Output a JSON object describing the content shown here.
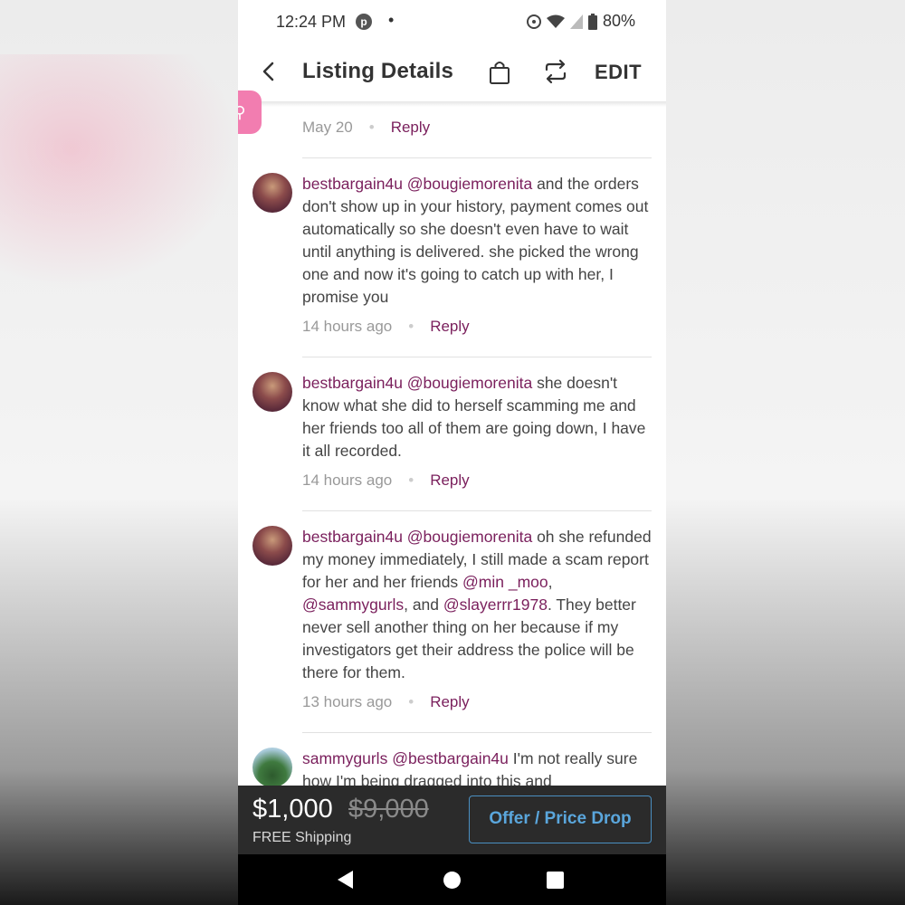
{
  "status_bar": {
    "time": "12:24 PM",
    "battery": "80%",
    "icons": [
      "pinterest-icon",
      "cast-icon",
      "wifi-icon",
      "signal-icon",
      "battery-icon"
    ]
  },
  "header": {
    "title": "Listing Details",
    "edit_label": "EDIT"
  },
  "prev_comment": {
    "date": "May 20",
    "reply": "Reply"
  },
  "comments": [
    {
      "user": "bestbargain4u",
      "mention": "@bougiemorenita",
      "text": " and the orders don't show up in your history, payment comes out automatically so she doesn't even have to wait until anything is delivered. she picked the wrong one and now it's going to catch up with her, I promise you",
      "time": "14 hours ago",
      "reply": "Reply"
    },
    {
      "user": "bestbargain4u",
      "mention": "@bougiemorenita",
      "text": " she doesn't know what she did to herself scamming me and her friends too all of them are going down, I have it all recorded.",
      "time": "14 hours ago",
      "reply": "Reply"
    },
    {
      "user": "bestbargain4u",
      "mention": "@bougiemorenita",
      "text_a": " oh she refunded my money immediately, I still made a scam report for her and her friends ",
      "mention_b": "@min _moo",
      "text_b": ", ",
      "mention_c": "@sammygurls",
      "text_c": ", and ",
      "mention_d": "@slayerrr1978",
      "text_d": ". They better never sell another thing on her because if my investigators get their address the police will be there for them.",
      "time": "13 hours ago",
      "reply": "Reply"
    },
    {
      "user": "sammygurls",
      "mention": "@bestbargain4u",
      "text": " I'm not really sure how I'm being dragged into this and"
    }
  ],
  "price_bar": {
    "price": "$1,000",
    "original_price": "$9,000",
    "shipping": "FREE Shipping",
    "offer_label": "Offer / Price Drop"
  },
  "colors": {
    "accent": "#7a1f5c",
    "offer_button": "#5aa6dc",
    "fab": "#f27db0"
  }
}
